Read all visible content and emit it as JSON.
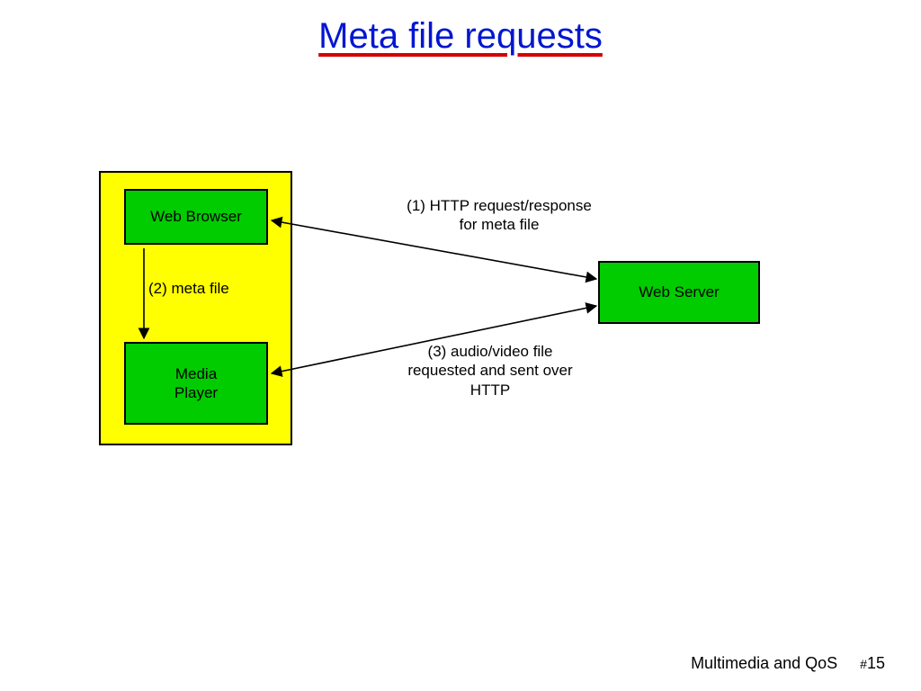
{
  "title": "Meta file requests",
  "boxes": {
    "web_browser": "Web Browser",
    "media_player": "Media\nPlayer",
    "web_server": "Web Server"
  },
  "edges": {
    "e1": "(1) HTTP request/response\nfor meta file",
    "e2": "(2)  meta file",
    "e3": "(3) audio/video file\nrequested and sent over\nHTTP"
  },
  "footer": {
    "topic": "Multimedia and QoS",
    "page": "15"
  }
}
